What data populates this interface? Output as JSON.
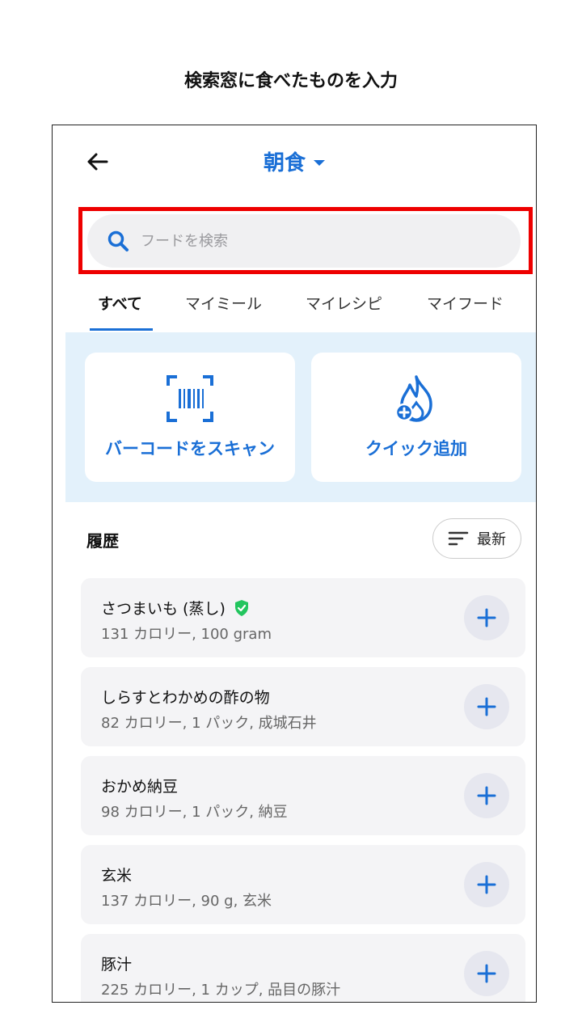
{
  "caption": "検索窓に食べたものを入力",
  "header": {
    "title": "朝食",
    "back_icon": "arrow-left-icon",
    "dropdown_icon": "caret-down-icon"
  },
  "search": {
    "placeholder": "フードを検索",
    "value": ""
  },
  "tabs": [
    {
      "label": "すべて",
      "active": true
    },
    {
      "label": "マイミール",
      "active": false
    },
    {
      "label": "マイレシピ",
      "active": false
    },
    {
      "label": "マイフード",
      "active": false
    }
  ],
  "quick_actions": [
    {
      "label": "バーコードをスキャン",
      "icon": "barcode-scan-icon"
    },
    {
      "label": "クイック追加",
      "icon": "quick-add-flame-icon"
    }
  ],
  "history": {
    "title": "履歴",
    "sort_label": "最新",
    "items": [
      {
        "name": "さつまいも (蒸し)",
        "detail": "131 カロリー, 100 gram",
        "verified": true
      },
      {
        "name": "しらすとわかめの酢の物",
        "detail": "82 カロリー, 1 パック, 成城石井",
        "verified": false
      },
      {
        "name": "おかめ納豆",
        "detail": "98 カロリー, 1 パック, 納豆",
        "verified": false
      },
      {
        "name": "玄米",
        "detail": "137 カロリー, 90 g, 玄米",
        "verified": false
      },
      {
        "name": "豚汁",
        "detail": "225 カロリー, 1 カップ, 品目の豚汁",
        "verified": false
      }
    ]
  },
  "colors": {
    "accent": "#1a6fd6",
    "highlight_border": "#ee0000",
    "verified_badge": "#22c55e",
    "quick_panel_bg": "#e3f1fb"
  }
}
